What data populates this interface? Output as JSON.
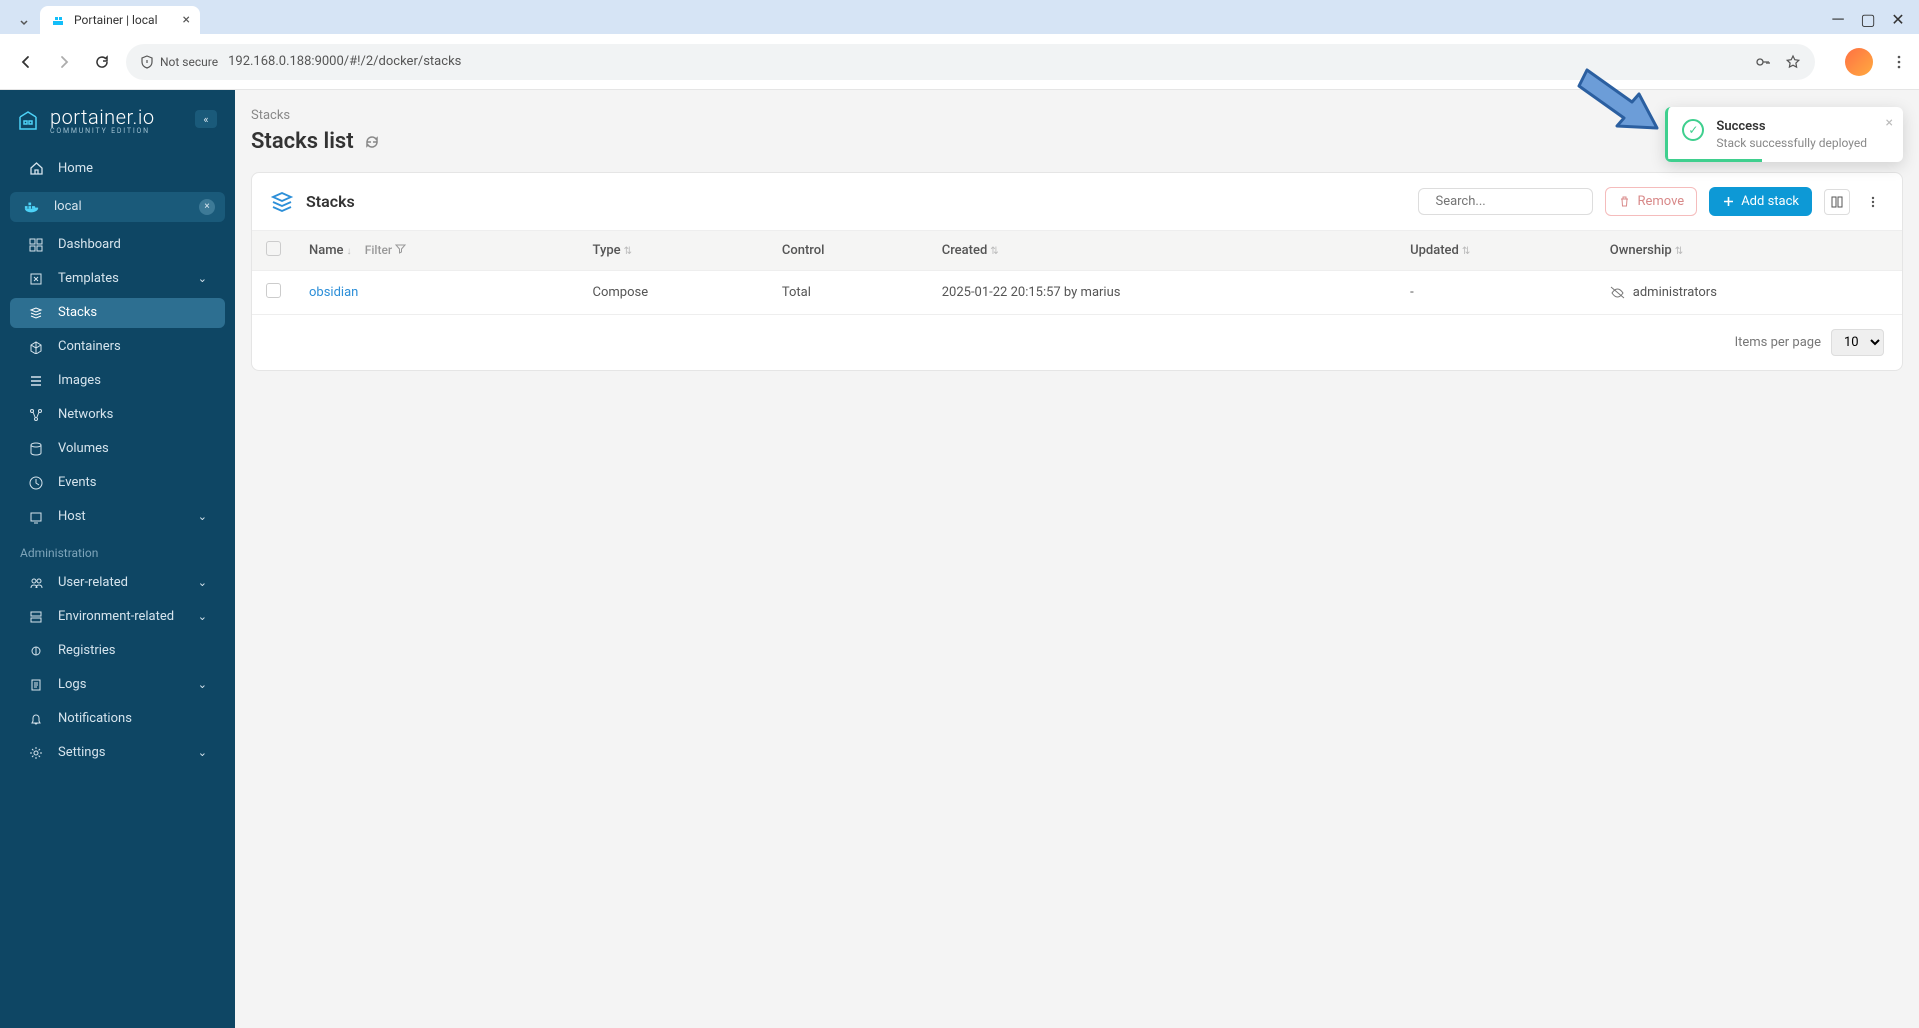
{
  "browser": {
    "tab_title": "Portainer | local",
    "url": "192.168.0.188:9000/#!/2/docker/stacks",
    "security_label": "Not secure"
  },
  "sidebar": {
    "logo_name": "portainer.io",
    "logo_sub": "COMMUNITY EDITION",
    "home": "Home",
    "env_name": "local",
    "items": [
      {
        "label": "Dashboard"
      },
      {
        "label": "Templates"
      },
      {
        "label": "Stacks"
      },
      {
        "label": "Containers"
      },
      {
        "label": "Images"
      },
      {
        "label": "Networks"
      },
      {
        "label": "Volumes"
      },
      {
        "label": "Events"
      },
      {
        "label": "Host"
      }
    ],
    "admin_section": "Administration",
    "admin_items": [
      {
        "label": "User-related"
      },
      {
        "label": "Environment-related"
      },
      {
        "label": "Registries"
      },
      {
        "label": "Logs"
      },
      {
        "label": "Notifications"
      },
      {
        "label": "Settings"
      }
    ]
  },
  "breadcrumb": "Stacks",
  "page_title": "Stacks list",
  "panel": {
    "title": "Stacks",
    "search_placeholder": "Search...",
    "remove_label": "Remove",
    "add_label": "Add stack"
  },
  "table": {
    "headers": {
      "name": "Name",
      "filter": "Filter",
      "type": "Type",
      "control": "Control",
      "created": "Created",
      "updated": "Updated",
      "ownership": "Ownership"
    },
    "rows": [
      {
        "name": "obsidian",
        "type": "Compose",
        "control": "Total",
        "created": "2025-01-22 20:15:57 by marius",
        "updated": "-",
        "ownership": "administrators"
      }
    ]
  },
  "pagination": {
    "label": "Items per page",
    "value": "10"
  },
  "toast": {
    "title": "Success",
    "message": "Stack successfully deployed"
  }
}
